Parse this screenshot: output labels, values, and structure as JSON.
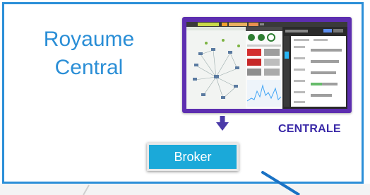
{
  "title": {
    "line1": "Royaume",
    "line2": "Central"
  },
  "central_label": "CENTRALE",
  "broker_label": "Broker",
  "colors": {
    "frame": "#2b8fd8",
    "title": "#2a8ed6",
    "screenshot_border": "#5d2eb0",
    "arrow": "#4b3aa8",
    "centrale": "#3b2aa8",
    "broker_fill": "#1ba9d9",
    "connector": "#1a72c4"
  },
  "icons": {
    "down_arrow": "arrow-down-icon"
  }
}
